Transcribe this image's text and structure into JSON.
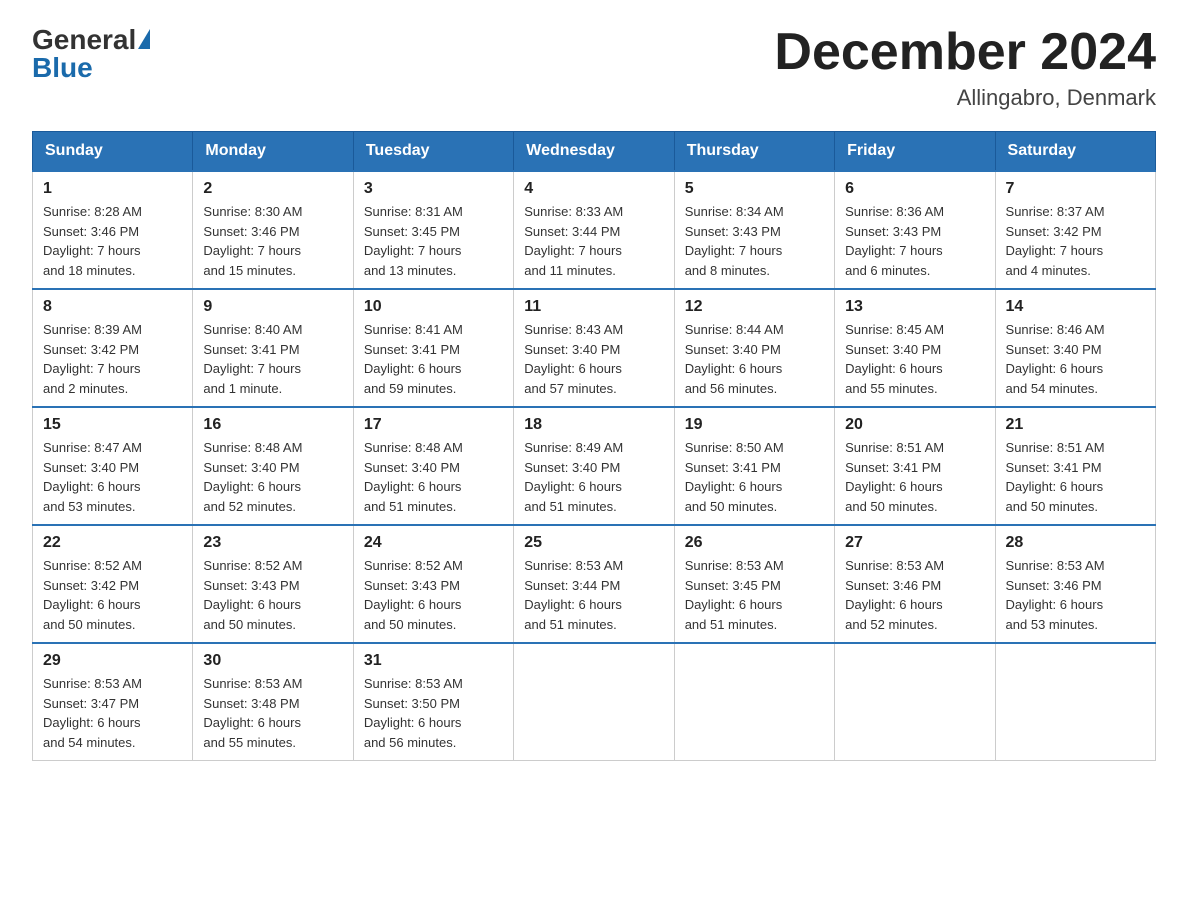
{
  "logo": {
    "text_general": "General",
    "text_blue": "Blue"
  },
  "title": "December 2024",
  "subtitle": "Allingabro, Denmark",
  "weekdays": [
    "Sunday",
    "Monday",
    "Tuesday",
    "Wednesday",
    "Thursday",
    "Friday",
    "Saturday"
  ],
  "weeks": [
    [
      {
        "day": "1",
        "info": "Sunrise: 8:28 AM\nSunset: 3:46 PM\nDaylight: 7 hours\nand 18 minutes."
      },
      {
        "day": "2",
        "info": "Sunrise: 8:30 AM\nSunset: 3:46 PM\nDaylight: 7 hours\nand 15 minutes."
      },
      {
        "day": "3",
        "info": "Sunrise: 8:31 AM\nSunset: 3:45 PM\nDaylight: 7 hours\nand 13 minutes."
      },
      {
        "day": "4",
        "info": "Sunrise: 8:33 AM\nSunset: 3:44 PM\nDaylight: 7 hours\nand 11 minutes."
      },
      {
        "day": "5",
        "info": "Sunrise: 8:34 AM\nSunset: 3:43 PM\nDaylight: 7 hours\nand 8 minutes."
      },
      {
        "day": "6",
        "info": "Sunrise: 8:36 AM\nSunset: 3:43 PM\nDaylight: 7 hours\nand 6 minutes."
      },
      {
        "day": "7",
        "info": "Sunrise: 8:37 AM\nSunset: 3:42 PM\nDaylight: 7 hours\nand 4 minutes."
      }
    ],
    [
      {
        "day": "8",
        "info": "Sunrise: 8:39 AM\nSunset: 3:42 PM\nDaylight: 7 hours\nand 2 minutes."
      },
      {
        "day": "9",
        "info": "Sunrise: 8:40 AM\nSunset: 3:41 PM\nDaylight: 7 hours\nand 1 minute."
      },
      {
        "day": "10",
        "info": "Sunrise: 8:41 AM\nSunset: 3:41 PM\nDaylight: 6 hours\nand 59 minutes."
      },
      {
        "day": "11",
        "info": "Sunrise: 8:43 AM\nSunset: 3:40 PM\nDaylight: 6 hours\nand 57 minutes."
      },
      {
        "day": "12",
        "info": "Sunrise: 8:44 AM\nSunset: 3:40 PM\nDaylight: 6 hours\nand 56 minutes."
      },
      {
        "day": "13",
        "info": "Sunrise: 8:45 AM\nSunset: 3:40 PM\nDaylight: 6 hours\nand 55 minutes."
      },
      {
        "day": "14",
        "info": "Sunrise: 8:46 AM\nSunset: 3:40 PM\nDaylight: 6 hours\nand 54 minutes."
      }
    ],
    [
      {
        "day": "15",
        "info": "Sunrise: 8:47 AM\nSunset: 3:40 PM\nDaylight: 6 hours\nand 53 minutes."
      },
      {
        "day": "16",
        "info": "Sunrise: 8:48 AM\nSunset: 3:40 PM\nDaylight: 6 hours\nand 52 minutes."
      },
      {
        "day": "17",
        "info": "Sunrise: 8:48 AM\nSunset: 3:40 PM\nDaylight: 6 hours\nand 51 minutes."
      },
      {
        "day": "18",
        "info": "Sunrise: 8:49 AM\nSunset: 3:40 PM\nDaylight: 6 hours\nand 51 minutes."
      },
      {
        "day": "19",
        "info": "Sunrise: 8:50 AM\nSunset: 3:41 PM\nDaylight: 6 hours\nand 50 minutes."
      },
      {
        "day": "20",
        "info": "Sunrise: 8:51 AM\nSunset: 3:41 PM\nDaylight: 6 hours\nand 50 minutes."
      },
      {
        "day": "21",
        "info": "Sunrise: 8:51 AM\nSunset: 3:41 PM\nDaylight: 6 hours\nand 50 minutes."
      }
    ],
    [
      {
        "day": "22",
        "info": "Sunrise: 8:52 AM\nSunset: 3:42 PM\nDaylight: 6 hours\nand 50 minutes."
      },
      {
        "day": "23",
        "info": "Sunrise: 8:52 AM\nSunset: 3:43 PM\nDaylight: 6 hours\nand 50 minutes."
      },
      {
        "day": "24",
        "info": "Sunrise: 8:52 AM\nSunset: 3:43 PM\nDaylight: 6 hours\nand 50 minutes."
      },
      {
        "day": "25",
        "info": "Sunrise: 8:53 AM\nSunset: 3:44 PM\nDaylight: 6 hours\nand 51 minutes."
      },
      {
        "day": "26",
        "info": "Sunrise: 8:53 AM\nSunset: 3:45 PM\nDaylight: 6 hours\nand 51 minutes."
      },
      {
        "day": "27",
        "info": "Sunrise: 8:53 AM\nSunset: 3:46 PM\nDaylight: 6 hours\nand 52 minutes."
      },
      {
        "day": "28",
        "info": "Sunrise: 8:53 AM\nSunset: 3:46 PM\nDaylight: 6 hours\nand 53 minutes."
      }
    ],
    [
      {
        "day": "29",
        "info": "Sunrise: 8:53 AM\nSunset: 3:47 PM\nDaylight: 6 hours\nand 54 minutes."
      },
      {
        "day": "30",
        "info": "Sunrise: 8:53 AM\nSunset: 3:48 PM\nDaylight: 6 hours\nand 55 minutes."
      },
      {
        "day": "31",
        "info": "Sunrise: 8:53 AM\nSunset: 3:50 PM\nDaylight: 6 hours\nand 56 minutes."
      },
      null,
      null,
      null,
      null
    ]
  ]
}
